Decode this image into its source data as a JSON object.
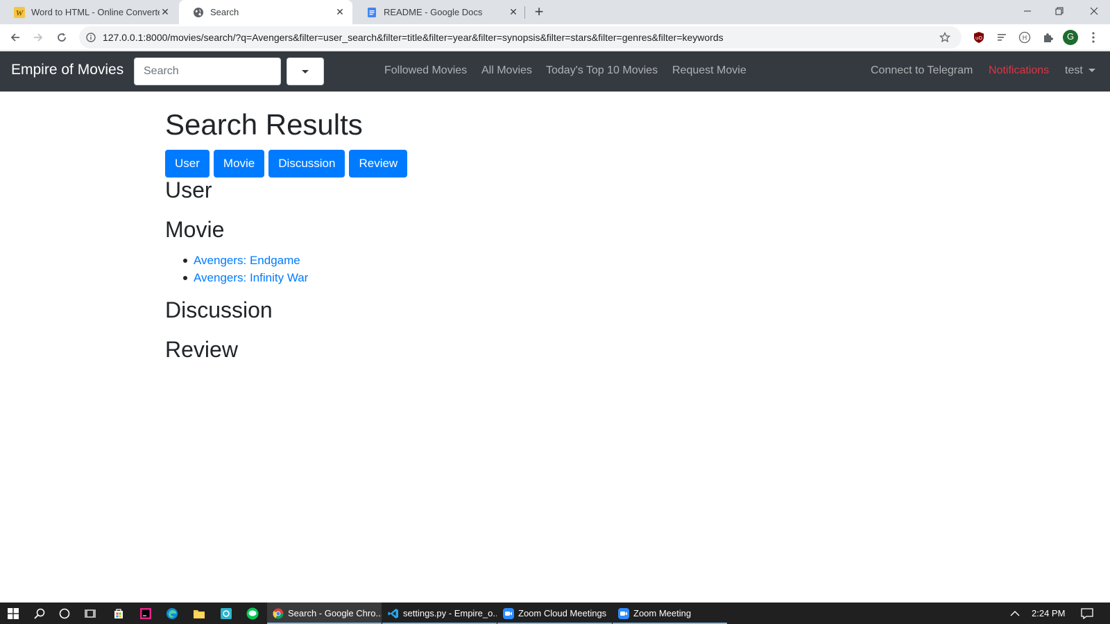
{
  "browser": {
    "tabs": [
      {
        "title": "Word to HTML - Online Converter",
        "favicon": "w-letter-icon"
      },
      {
        "title": "Search",
        "favicon": "globe-icon",
        "active": true
      },
      {
        "title": "README - Google Docs",
        "favicon": "docs-icon"
      }
    ],
    "url": "127.0.0.1:8000/movies/search/?q=Avengers&filter=user_search&filter=title&filter=year&filter=synopsis&filter=stars&filter=genres&filter=keywords",
    "profile_initial": "G",
    "new_tab_symbol": "+"
  },
  "navbar": {
    "brand": "Empire of Movies",
    "search_placeholder": "Search",
    "links": [
      "Followed Movies",
      "All Movies",
      "Today's Top 10 Movies",
      "Request Movie"
    ],
    "right_links": {
      "telegram": "Connect to Telegram",
      "notifications": "Notifications",
      "user": "test"
    },
    "notifications_color": "#dc3545"
  },
  "page": {
    "title": "Search Results",
    "filter_buttons": [
      "User",
      "Movie",
      "Discussion",
      "Review"
    ],
    "sections": {
      "user": {
        "heading": "User",
        "items": []
      },
      "movie": {
        "heading": "Movie",
        "items": [
          "Avengers: Endgame",
          "Avengers: Infinity War"
        ]
      },
      "discussion": {
        "heading": "Discussion",
        "items": []
      },
      "review": {
        "heading": "Review",
        "items": []
      }
    },
    "accent_color": "#007bff"
  },
  "taskbar": {
    "apps": [
      {
        "label": "Search - Google Chro...",
        "icon": "chrome-icon",
        "active": true
      },
      {
        "label": "settings.py - Empire_o...",
        "icon": "vscode-icon"
      },
      {
        "label": "Zoom Cloud Meetings",
        "icon": "zoom-icon"
      },
      {
        "label": "Zoom Meeting",
        "icon": "zoom-icon"
      }
    ],
    "clock": "2:24 PM"
  }
}
